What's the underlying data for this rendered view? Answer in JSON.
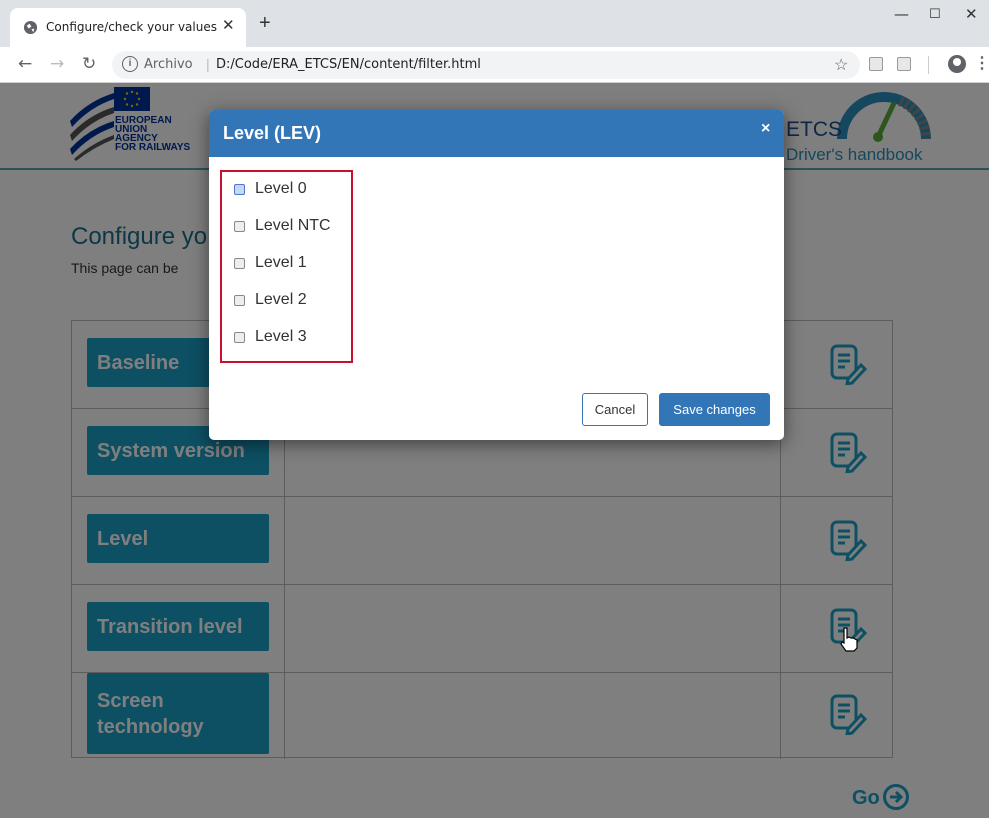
{
  "browser": {
    "tab_title": "Configure/check your values",
    "url_scheme": "Archivo",
    "url": "D:/Code/ERA_ETCS/EN/content/filter.html"
  },
  "header": {
    "eu_text": [
      "EUROPEAN",
      "UNION",
      "AGENCY",
      "FOR RAILWAYS"
    ],
    "app_title": "ETCS",
    "app_subtitle": "Driver's handbook"
  },
  "page": {
    "heading": "Configure yo",
    "description": "This page can be"
  },
  "parameters": [
    {
      "label": "Baseline"
    },
    {
      "label": "System version"
    },
    {
      "label": "Level"
    },
    {
      "label": "Transition level"
    },
    {
      "label": "Screen technology"
    }
  ],
  "go_label": "Go",
  "modal": {
    "title": "Level (LEV)",
    "close": "×",
    "options": [
      {
        "label": "Level 0",
        "checked": false
      },
      {
        "label": "Level NTC",
        "checked": false
      },
      {
        "label": "Level 1",
        "checked": false
      },
      {
        "label": "Level 2",
        "checked": false
      },
      {
        "label": "Level 3",
        "checked": false
      }
    ],
    "cancel_label": "Cancel",
    "save_label": "Save changes"
  },
  "colors": {
    "modal_header": "#3376b8",
    "param_button": "#1aa0c7",
    "highlight_box": "#c8102e",
    "eu_blue": "#003399"
  }
}
